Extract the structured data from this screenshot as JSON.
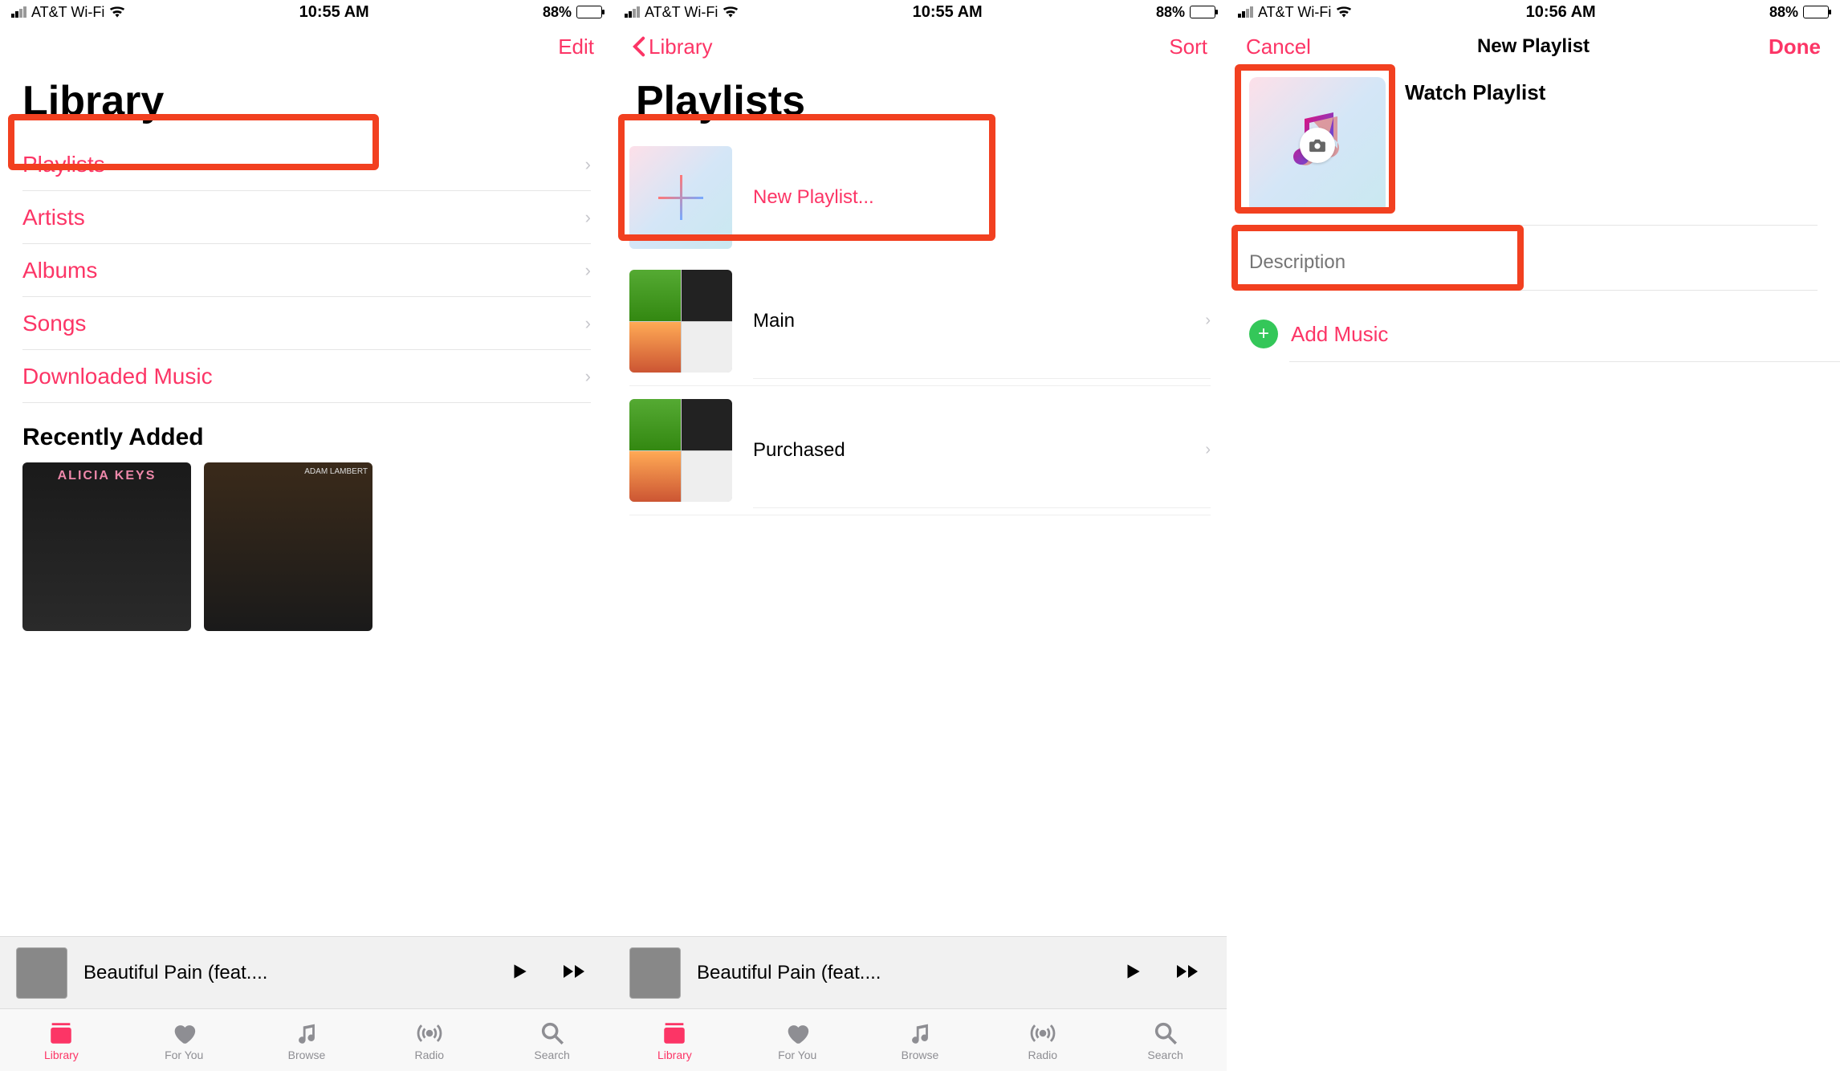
{
  "status": {
    "carrier": "AT&T Wi-Fi",
    "time1": "10:55 AM",
    "time2": "10:55 AM",
    "time3": "10:56 AM",
    "battery": "88%"
  },
  "pane1": {
    "edit": "Edit",
    "title": "Library",
    "rows": [
      "Playlists",
      "Artists",
      "Albums",
      "Songs",
      "Downloaded Music"
    ],
    "recent": "Recently Added"
  },
  "pane2": {
    "back": "Library",
    "sort": "Sort",
    "title": "Playlists",
    "new": "New Playlist...",
    "items": [
      "Main",
      "Purchased"
    ]
  },
  "pane3": {
    "cancel": "Cancel",
    "done": "Done",
    "title": "New Playlist",
    "name": "Watch Playlist",
    "desc_placeholder": "Description",
    "add": "Add Music"
  },
  "mini": {
    "track": "Beautiful Pain (feat...."
  },
  "tabs": [
    "Library",
    "For You",
    "Browse",
    "Radio",
    "Search"
  ]
}
